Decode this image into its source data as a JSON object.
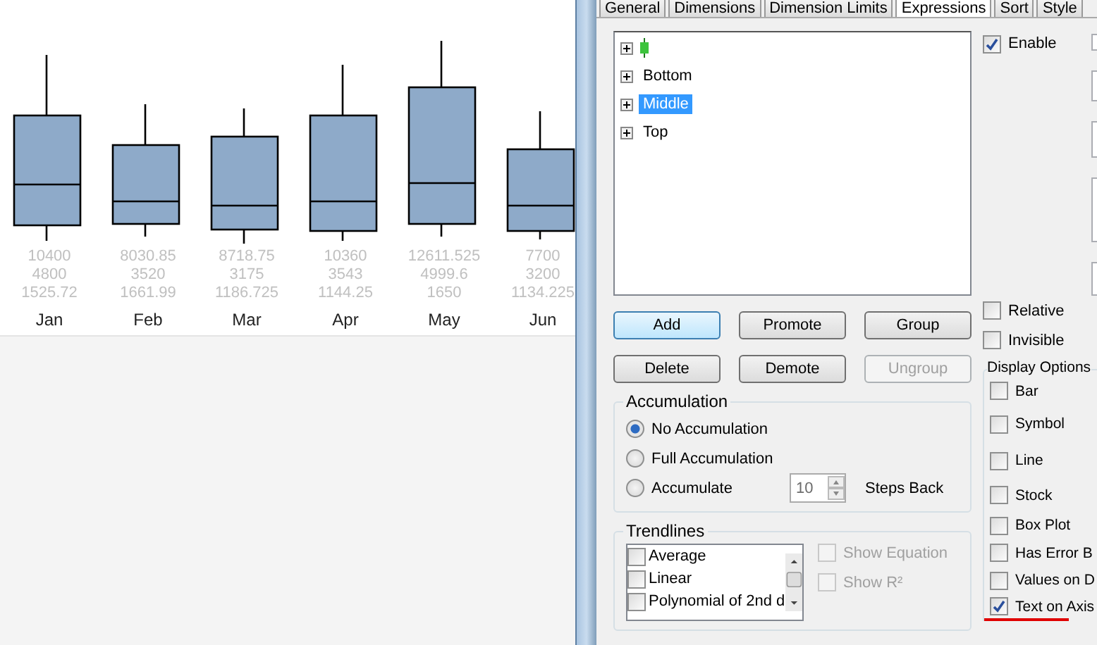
{
  "chart": {
    "columns": [
      {
        "label": "Jan",
        "values": [
          "10400",
          "4800",
          "1525.72"
        ]
      },
      {
        "label": "Feb",
        "values": [
          "8030.85",
          "3520",
          "1661.99"
        ]
      },
      {
        "label": "Mar",
        "values": [
          "8718.75",
          "3175",
          "1186.725"
        ]
      },
      {
        "label": "Apr",
        "values": [
          "10360",
          "3543",
          "1144.25"
        ]
      },
      {
        "label": "May",
        "values": [
          "12611.525",
          "4999.6",
          "1650"
        ]
      },
      {
        "label": "Jun",
        "values": [
          "7700",
          "3200",
          "1134.225"
        ]
      }
    ]
  },
  "dialog": {
    "tabs": [
      {
        "label": "General",
        "selected": false
      },
      {
        "label": "Dimensions",
        "selected": false
      },
      {
        "label": "Dimension Limits",
        "selected": false
      },
      {
        "label": "Expressions",
        "selected": true
      },
      {
        "label": "Sort",
        "selected": false
      },
      {
        "label": "Style",
        "selected": false
      }
    ],
    "tree": [
      {
        "kind": "icon",
        "selected": false
      },
      {
        "kind": "text",
        "label": "Bottom",
        "selected": false
      },
      {
        "kind": "text",
        "label": "Middle",
        "selected": true
      },
      {
        "kind": "text",
        "label": "Top",
        "selected": false
      }
    ],
    "enable": {
      "label": "Enable",
      "checked": true
    },
    "buttons": [
      {
        "label": "Add",
        "disabled": false,
        "default": true
      },
      {
        "label": "Promote",
        "disabled": false,
        "default": false
      },
      {
        "label": "Group",
        "disabled": false,
        "default": false
      },
      {
        "label": "Delete",
        "disabled": false,
        "default": false
      },
      {
        "label": "Demote",
        "disabled": false,
        "default": false
      },
      {
        "label": "Ungroup",
        "disabled": true,
        "default": false
      }
    ],
    "accumulation": {
      "title": "Accumulation",
      "options": [
        {
          "label": "No Accumulation",
          "selected": true
        },
        {
          "label": "Full Accumulation",
          "selected": false
        },
        {
          "label": "Accumulate",
          "selected": false
        }
      ],
      "steps": "10",
      "steps_label": "Steps Back"
    },
    "trendlines": {
      "title": "Trendlines",
      "items": [
        {
          "label": "Average",
          "checked": false
        },
        {
          "label": "Linear",
          "checked": false
        },
        {
          "label": "Polynomial of 2nd d",
          "checked": false
        }
      ],
      "options": [
        {
          "label": "Show Equation",
          "checked": false,
          "disabled": true
        },
        {
          "label": "Show R²",
          "checked": false,
          "disabled": true
        }
      ]
    },
    "flags": [
      {
        "label": "Relative",
        "checked": false
      },
      {
        "label": "Invisible",
        "checked": false
      }
    ],
    "display_options": {
      "title": "Display Options",
      "items": [
        {
          "label": "Bar",
          "checked": false
        },
        {
          "label": "Symbol",
          "checked": false
        },
        {
          "label": "Line",
          "checked": false
        },
        {
          "label": "Stock",
          "checked": false
        },
        {
          "label": "Box Plot",
          "checked": false
        },
        {
          "label": "Has Error B",
          "checked": false
        },
        {
          "label": "Values on D",
          "checked": false
        },
        {
          "label": "Text on Axis",
          "checked": true
        }
      ]
    }
  }
}
